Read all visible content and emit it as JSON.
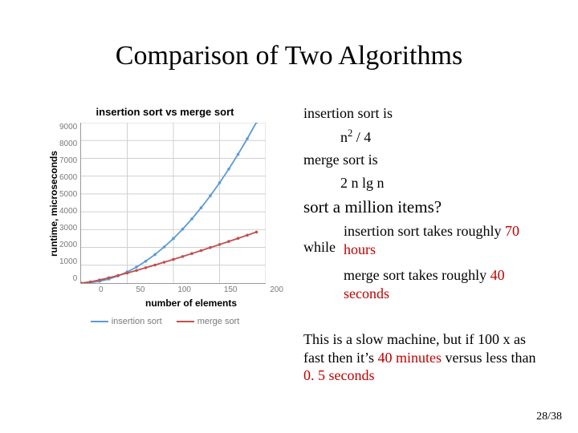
{
  "title": "Comparison of Two Algorithms",
  "page": "28/38",
  "chart": {
    "title": "insertion sort vs merge sort",
    "ylabel": "runtime, microseconds",
    "xlabel": "number of elements",
    "yticks": [
      "9000",
      "8000",
      "7000",
      "6000",
      "5000",
      "4000",
      "3000",
      "2000",
      "1000",
      "0"
    ],
    "xticks": [
      "0",
      "50",
      "100",
      "150",
      "200"
    ],
    "legend": {
      "s1": "insertion sort",
      "s2": "merge sort"
    }
  },
  "notes": {
    "ins_label": "insertion sort is",
    "ins_formula_pre": "n",
    "ins_formula_sup": "2",
    "ins_formula_post": " / 4",
    "mrg_label": "merge sort is",
    "mrg_formula": "2 n lg n",
    "question": "sort a million items?",
    "while": "while",
    "ins_takes_a": "insertion sort takes roughly ",
    "ins_takes_b": "70 hours",
    "mrg_takes_a": "merge sort takes roughly ",
    "mrg_takes_b": "40 seconds",
    "footer_a": "This is a slow machine, but if 100 x as fast then it’s ",
    "footer_b": "40 minutes",
    "footer_c": " versus less than ",
    "footer_d": "0. 5 seconds"
  },
  "chart_data": {
    "type": "line",
    "title": "insertion sort vs merge sort",
    "xlabel": "number of elements",
    "ylabel": "runtime, microseconds",
    "xlim": [
      0,
      200
    ],
    "ylim": [
      0,
      9000
    ],
    "x": [
      0,
      10,
      20,
      30,
      40,
      50,
      60,
      70,
      80,
      90,
      100,
      110,
      120,
      130,
      140,
      150,
      160,
      170,
      180,
      190
    ],
    "series": [
      {
        "name": "insertion sort",
        "values": [
          0,
          25,
          100,
          225,
          400,
          625,
          900,
          1225,
          1600,
          2025,
          2500,
          3025,
          3600,
          4225,
          4900,
          5625,
          6400,
          7225,
          8100,
          9025
        ]
      },
      {
        "name": "merge sort",
        "values": [
          0,
          66,
          173,
          294,
          425,
          564,
          709,
          859,
          1012,
          1169,
          1329,
          1491,
          1656,
          1823,
          1992,
          2163,
          2335,
          2510,
          2685,
          2862
        ]
      }
    ],
    "legend_position": "bottom",
    "grid": true
  }
}
